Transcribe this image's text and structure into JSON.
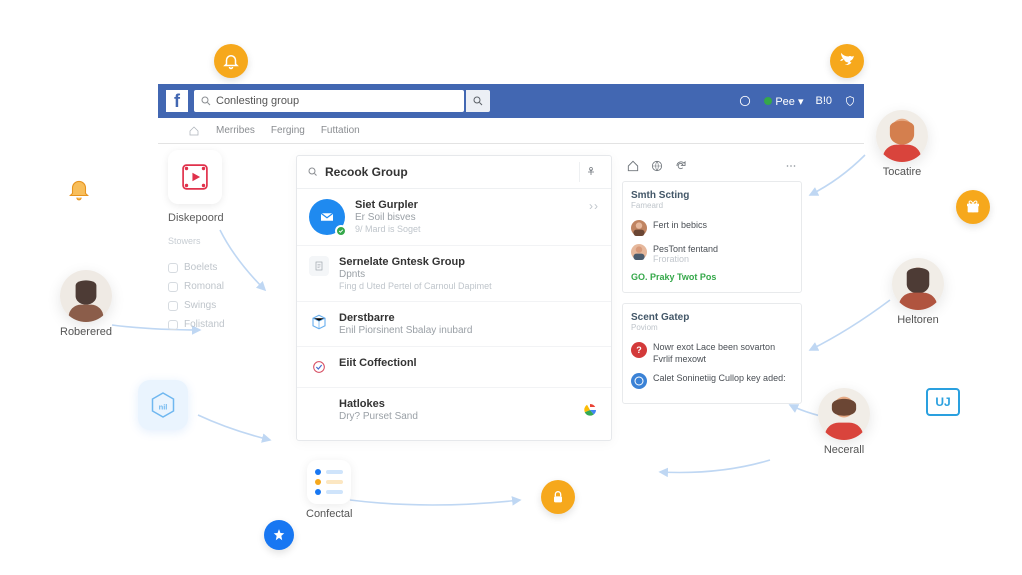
{
  "header": {
    "logo_letter": "f",
    "search_value": "Conlesting group",
    "right": {
      "badge1": "Pee",
      "badge2": "B!0"
    }
  },
  "tabs": {
    "t1": "Merribes",
    "t2": "Ferging",
    "t3": "Futtation"
  },
  "left": {
    "tile_label": "Diskepoord",
    "sub1": "Stowers",
    "nav1": "Boelets",
    "nav2": "Romonal",
    "nav3": "Swings",
    "nav4": "Folistand"
  },
  "center": {
    "title": "Recook Group",
    "item1": {
      "title": "Siet Gurpler",
      "sub": "Er Soil bisves",
      "sub2": "9/ Mard is Soget"
    },
    "item2": {
      "title": "Sernelate Gntesk Group",
      "sub": "Dpnts",
      "sub2": "Fing d Uted Pertel of Carnoul Dapimet"
    },
    "item3": {
      "title": "Derstbarre",
      "sub": "Enil Piorsinent Sbalay inubard"
    },
    "item4": {
      "title": "Eiit Coffectionl"
    },
    "item5": {
      "title": "Hatlokes",
      "sub": "Dry? Purset Sand"
    }
  },
  "right": {
    "card1": {
      "title": "Smth Scting",
      "sub": "Fameard",
      "row1": "Fert in bebics",
      "row2": "PesTont fentand",
      "row2s": "Froration",
      "link": "GO. Praky Twot Pos"
    },
    "card2": {
      "title": "Scent Gatep",
      "sub": "Poviom",
      "row1": "Nowr exot Lace been sovarton Fvrlif mexowt",
      "row2": "Calet Soninetiig Cullop key aded:"
    }
  },
  "avatars": {
    "a1": "Roberered",
    "a2": "Confectal",
    "a3": "Tocatire",
    "a4": "Heltoren",
    "a5": "Necerall"
  },
  "monitor": "UJ"
}
